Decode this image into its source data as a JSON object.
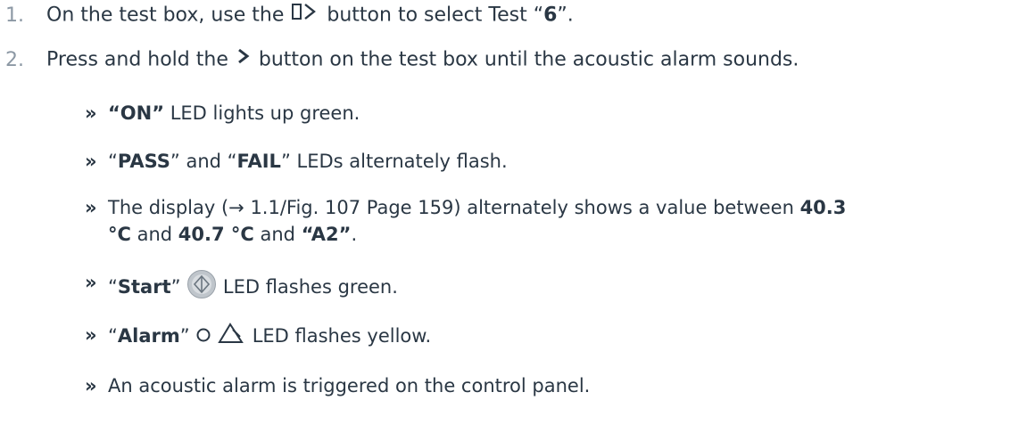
{
  "steps": [
    {
      "number": "1.",
      "text_before": "On the test box, use the ",
      "icon": "test-select-button-icon",
      "text_mid": " button to select Test “",
      "bold": "6",
      "text_after": "”."
    },
    {
      "number": "2.",
      "text_before": "Press and hold the ",
      "icon": "chevron-right-button-icon",
      "text_after": " button on the test box until the acoustic alarm sounds."
    }
  ],
  "results": {
    "bullet": "»",
    "r1": {
      "bold": "“ON”",
      "text": " LED lights up green."
    },
    "r2": {
      "q1": "“",
      "b1": "PASS",
      "mid": "” and “",
      "b2": "FAIL",
      "end": "” LEDs alternately flash."
    },
    "r3": {
      "t1": "The display (",
      "link": "→ 1.1/Fig. 107 Page 159",
      "t2": ") alternately shows a value between ",
      "b1": "40.3",
      "b2": "°C",
      "t3": " and ",
      "b3": "40.7 °C",
      "t4": " and ",
      "b4": "“A2”",
      "t5": "."
    },
    "r4": {
      "q1": "“",
      "bold": "Start",
      "q2": "”",
      "icon": "start-button-icon",
      "text": " LED flashes green."
    },
    "r5": {
      "q1": "“",
      "bold": "Alarm",
      "q2": "”",
      "icons": [
        "circle-icon",
        "warning-triangle-icon"
      ],
      "text": " LED flashes yellow."
    },
    "r6": {
      "text": "An acoustic alarm is triggered on the control panel."
    }
  },
  "colors": {
    "text": "#2a3744",
    "step_number": "#8c98a4",
    "start_button_fill": "#bfc5cb"
  }
}
